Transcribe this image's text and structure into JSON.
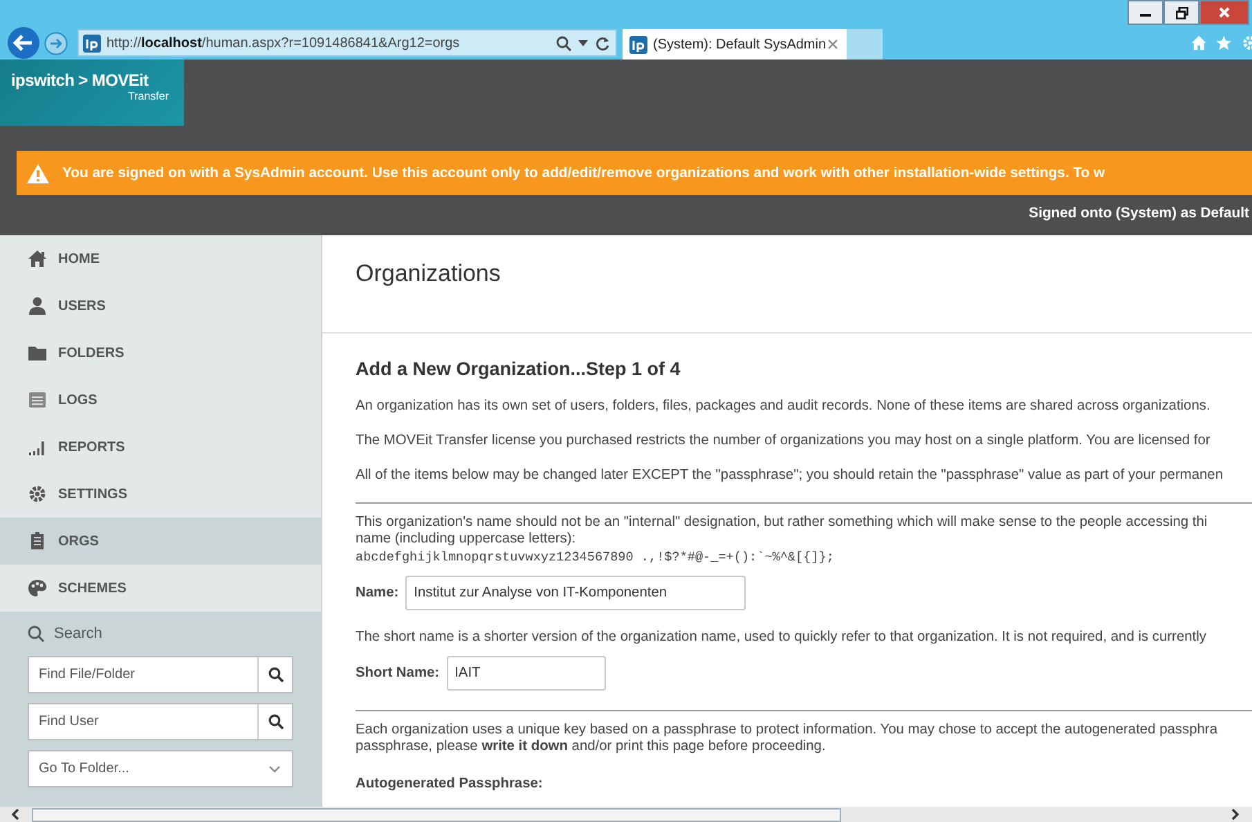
{
  "browser": {
    "url": "http://**localhost**/human.aspx?r=1091486841&Arg12=orgs",
    "tab_title": "(System): Default SysAdmin"
  },
  "header": {
    "logo_brand": "ipswitch > MOVEit",
    "logo_sub": "Transfer"
  },
  "banner": {
    "text": "You are signed on with a SysAdmin account. Use this account only to add/edit/remove organizations and work with other installation-wide settings. To w"
  },
  "signed_on": "Signed onto (System) as Default",
  "sidebar": {
    "items": [
      {
        "label": "HOME",
        "selected": false
      },
      {
        "label": "USERS",
        "selected": false
      },
      {
        "label": "FOLDERS",
        "selected": false
      },
      {
        "label": "LOGS",
        "selected": false
      },
      {
        "label": "REPORTS",
        "selected": false
      },
      {
        "label": "SETTINGS",
        "selected": false
      },
      {
        "label": "ORGS",
        "selected": true
      },
      {
        "label": "SCHEMES",
        "selected": false
      }
    ],
    "search": {
      "label": "Search",
      "fields": [
        {
          "kind": "search",
          "placeholder": "Find File/Folder"
        },
        {
          "kind": "search",
          "placeholder": "Find User"
        },
        {
          "kind": "select",
          "value": "Go To Folder..."
        }
      ]
    }
  },
  "content": {
    "title": "Organizations",
    "subtitle": "Add a New Organization...Step 1 of 4",
    "blocks": [
      {
        "kind": "paragraph",
        "text": "An organization has its own set of users, folders, files, packages and audit records. None of these items are shared across organizations."
      },
      {
        "kind": "paragraph",
        "text": "The MOVEit Transfer license you purchased restricts the number of organizations you may host on a single platform. You are licensed for"
      },
      {
        "kind": "paragraph",
        "text": "All of the items below may be changed later EXCEPT the \"passphrase\"; you should retain the \"passphrase\" value as part of your permanen"
      },
      {
        "kind": "rule"
      },
      {
        "kind": "line",
        "text": "This organization's name should not be an \"internal\" designation, but rather something which will make sense to the people accessing thi"
      },
      {
        "kind": "line",
        "text": "name (including uppercase letters):"
      },
      {
        "kind": "charset",
        "text": "abcdefghijklmnopqrstuvwxyz1234567890 .,!$?*#@-_=+():`~%^&[{]};"
      },
      {
        "kind": "field",
        "label": "Name:",
        "value": "Institut zur Analyse von IT-Komponenten"
      },
      {
        "kind": "paragraph",
        "text": "The short name is a shorter version of the organization name, used to quickly refer to that organization. It is not required, and is currently"
      },
      {
        "kind": "field",
        "label": "Short Name:",
        "value": "IAIT"
      },
      {
        "kind": "rule"
      },
      {
        "kind": "line",
        "text": "Each organization uses a unique key based on a passphrase to protect information. You may chose to accept the autogenerated passphra"
      },
      {
        "kind": "line",
        "text": "passphrase, please **write it down** and/or print this page before proceeding."
      },
      {
        "kind": "heading",
        "text": "Autogenerated Passphrase:"
      }
    ]
  }
}
